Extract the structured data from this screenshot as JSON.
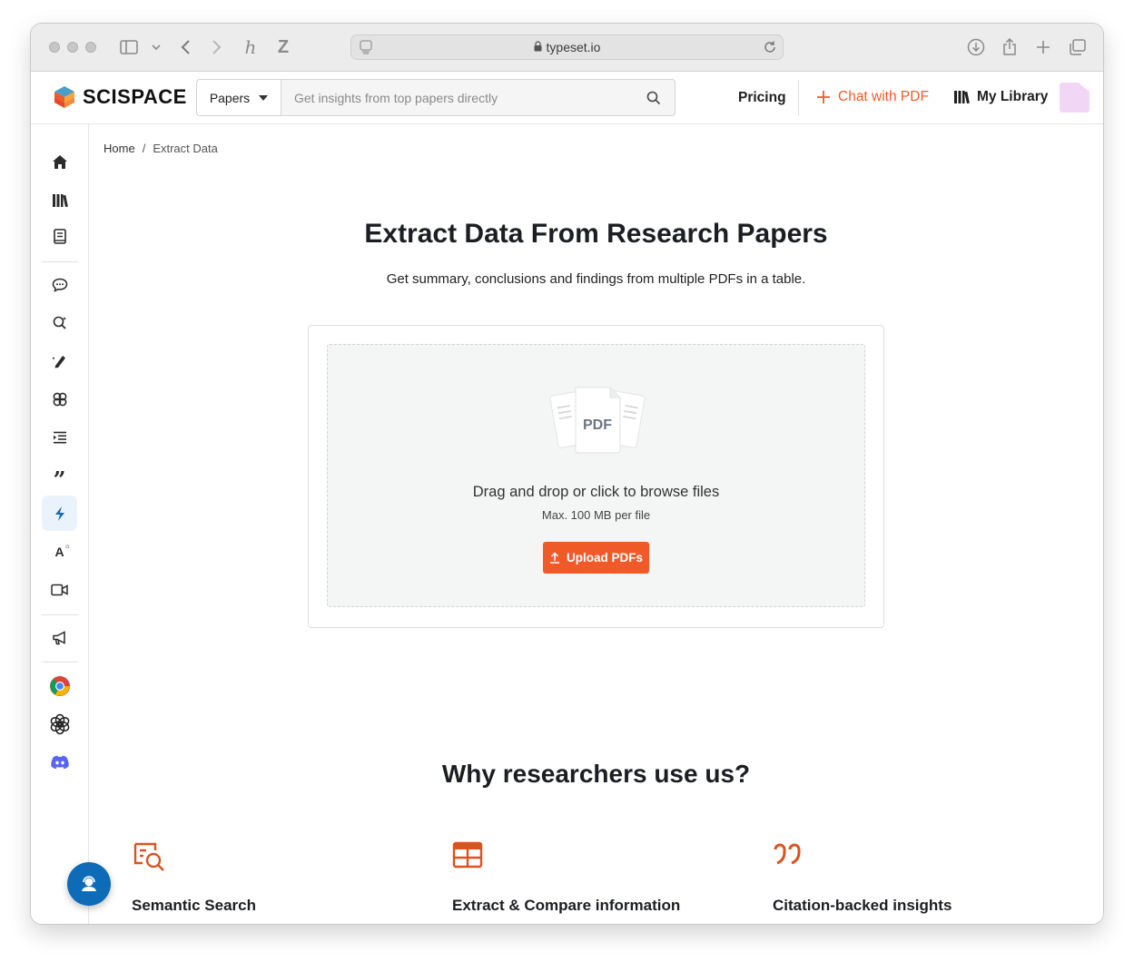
{
  "browser": {
    "url": "typeset.io"
  },
  "header": {
    "logo_text": "SCISPACE",
    "search": {
      "category": "Papers",
      "placeholder": "Get insights from top papers directly"
    },
    "nav": {
      "pricing": "Pricing",
      "chat_with_pdf": "Chat with PDF",
      "my_library": "My Library"
    }
  },
  "sidebar": {
    "items": [
      {
        "icon": "home-icon"
      },
      {
        "icon": "library-icon"
      },
      {
        "icon": "notebook-icon"
      },
      {
        "icon": "chat-pdf-icon"
      },
      {
        "icon": "literature-review-icon"
      },
      {
        "icon": "ai-writer-icon"
      },
      {
        "icon": "find-topics-icon"
      },
      {
        "icon": "paraphraser-icon"
      },
      {
        "icon": "citation-generator-icon"
      },
      {
        "icon": "extract-data-icon",
        "active": true
      },
      {
        "icon": "ai-detector-icon"
      },
      {
        "icon": "video-icon"
      },
      {
        "icon": "announcements-icon"
      },
      {
        "icon": "chrome-extension-icon"
      },
      {
        "icon": "chatgpt-plugin-icon"
      },
      {
        "icon": "discord-icon"
      }
    ]
  },
  "breadcrumb": {
    "home": "Home",
    "separator": "/",
    "current": "Extract Data"
  },
  "hero": {
    "title": "Extract Data From Research Papers",
    "subtitle": "Get summary, conclusions and findings from multiple PDFs in a table."
  },
  "upload": {
    "illustration_label": "PDF",
    "drop_text": "Drag and drop or click to browse files",
    "limit_text": "Max. 100 MB per file",
    "button_label": "Upload PDFs"
  },
  "why": {
    "title": "Why researchers use us?",
    "features": [
      {
        "icon": "semantic-search-icon",
        "title": "Semantic Search"
      },
      {
        "icon": "table-icon",
        "title": "Extract & Compare information"
      },
      {
        "icon": "quote-icon",
        "title": "Citation-backed insights"
      }
    ]
  },
  "colors": {
    "brand_orange": "#f05a28",
    "active_blue": "#0e6bb8",
    "feature_icon": "#d9541e"
  }
}
